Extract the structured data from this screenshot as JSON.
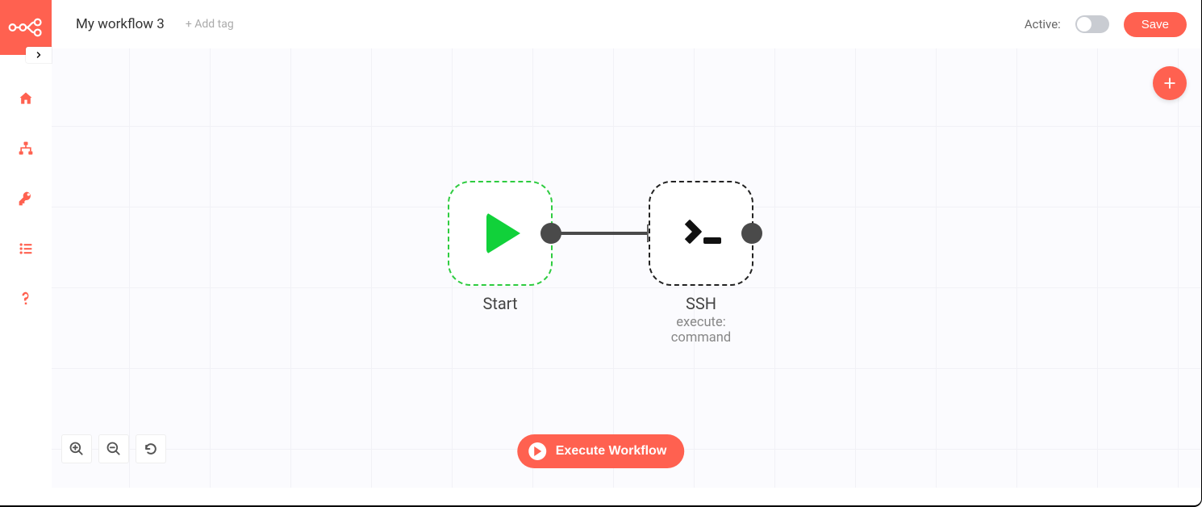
{
  "header": {
    "workflow_title": "My workflow 3",
    "add_tag_label": "+ Add tag",
    "active_label": "Active:",
    "active_state": false,
    "save_label": "Save"
  },
  "sidebar": {
    "items": [
      {
        "name": "home",
        "icon": "home-icon"
      },
      {
        "name": "workflows",
        "icon": "workflows-icon"
      },
      {
        "name": "credentials",
        "icon": "key-icon"
      },
      {
        "name": "executions",
        "icon": "list-icon"
      },
      {
        "name": "help",
        "icon": "question-icon"
      }
    ]
  },
  "canvas": {
    "nodes": [
      {
        "id": "start",
        "title": "Start",
        "subtitle": ""
      },
      {
        "id": "ssh",
        "title": "SSH",
        "subtitle": "execute: command"
      }
    ],
    "edges": [
      {
        "from": "start",
        "to": "ssh"
      }
    ]
  },
  "controls": {
    "zoom_in": "zoom-in",
    "zoom_out": "zoom-out",
    "reset": "reset-view",
    "execute_label": "Execute Workflow",
    "add_node": "+"
  },
  "colors": {
    "accent": "#ff6150",
    "start_border": "#2ecc40",
    "node_border": "#222222"
  }
}
